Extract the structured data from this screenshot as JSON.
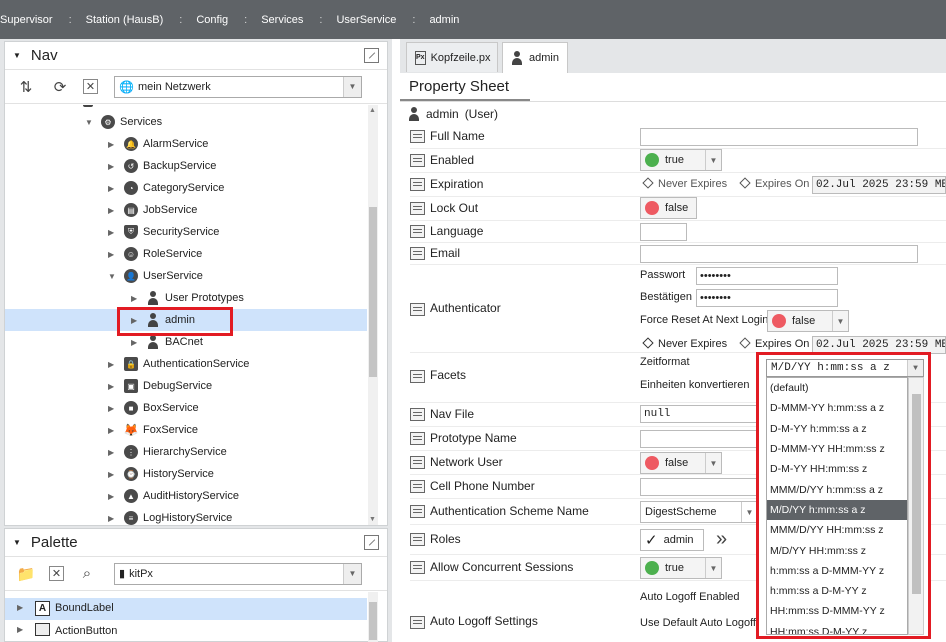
{
  "breadcrumb": [
    "Supervisor",
    "Station (HausB)",
    "Config",
    "Services",
    "UserService",
    "admin"
  ],
  "nav": {
    "title": "Nav",
    "network": "mein Netzwerk",
    "tree": [
      {
        "label": "Services",
        "level": 0,
        "expanded": true
      },
      {
        "label": "AlarmService",
        "level": 1
      },
      {
        "label": "BackupService",
        "level": 1
      },
      {
        "label": "CategoryService",
        "level": 1
      },
      {
        "label": "JobService",
        "level": 1
      },
      {
        "label": "SecurityService",
        "level": 1
      },
      {
        "label": "RoleService",
        "level": 1
      },
      {
        "label": "UserService",
        "level": 1,
        "expanded": true
      },
      {
        "label": "User Prototypes",
        "level": 2
      },
      {
        "label": "admin",
        "level": 2,
        "selected": true
      },
      {
        "label": "BACnet",
        "level": 2
      },
      {
        "label": "AuthenticationService",
        "level": 1
      },
      {
        "label": "DebugService",
        "level": 1
      },
      {
        "label": "BoxService",
        "level": 1
      },
      {
        "label": "FoxService",
        "level": 1
      },
      {
        "label": "HierarchyService",
        "level": 1
      },
      {
        "label": "HistoryService",
        "level": 1
      },
      {
        "label": "AuditHistoryService",
        "level": 1
      },
      {
        "label": "LogHistoryService",
        "level": 1
      }
    ]
  },
  "palette": {
    "title": "Palette",
    "module": "kitPx",
    "items": [
      "BoundLabel",
      "ActionButton"
    ]
  },
  "tabs": [
    "Kopfzeile.px",
    "admin"
  ],
  "property_sheet": {
    "title": "Property Sheet",
    "root": "admin",
    "root_type": "(User)",
    "full_name_label": "Full Name",
    "enabled_label": "Enabled",
    "enabled_value": "true",
    "expiration_label": "Expiration",
    "never_expires": "Never Expires",
    "expires_on": "Expires On",
    "expiration_date": "02.Jul 2025 23:59 ME",
    "lockout_label": "Lock Out",
    "lockout_value": "false",
    "language_label": "Language",
    "email_label": "Email",
    "authenticator_label": "Authenticator",
    "passwort_label": "Passwort",
    "passwort_value": "••••••••",
    "bestaetigen_label": "Bestätigen",
    "bestaetigen_value": "••••••••",
    "force_reset_label": "Force Reset At Next Login",
    "force_reset_value": "false",
    "auth_never_expires": "Never Expires",
    "auth_expires_on": "Expires On",
    "auth_expiration_date": "02.Jul 2025 23:59 ME",
    "facets_label": "Facets",
    "zeitformat_label": "Zeitformat",
    "einheiten_label": "Einheiten konvertieren",
    "nav_file_label": "Nav File",
    "nav_file_value": "null",
    "prototype_label": "Prototype Name",
    "network_user_label": "Network User",
    "network_user_value": "false",
    "cell_phone_label": "Cell Phone Number",
    "auth_scheme_label": "Authentication Scheme Name",
    "auth_scheme_value": "DigestScheme",
    "roles_label": "Roles",
    "roles_value": "admin",
    "concurrent_label": "Allow Concurrent Sessions",
    "concurrent_value": "true",
    "auto_logoff_label": "Auto Logoff Settings",
    "auto_logoff_enabled": "Auto Logoff Enabled",
    "use_default_auto": "Use Default Auto Logoff"
  },
  "zeitformat_dropdown": {
    "current": "M/D/YY h:mm:ss a z",
    "options": [
      "(default)",
      "D-MMM-YY h:mm:ss a z",
      "D-M-YY h:mm:ss a z",
      "D-MMM-YY HH:mm:ss z",
      "D-M-YY HH:mm:ss z",
      "MMM/D/YY h:mm:ss a z",
      "M/D/YY h:mm:ss a z",
      "MMM/D/YY HH:mm:ss z",
      "M/D/YY HH:mm:ss z",
      "h:mm:ss a D-MMM-YY z",
      "h:mm:ss a D-M-YY z",
      "HH:mm:ss D-MMM-YY z",
      "HH:mm:ss D-M-YY z"
    ],
    "selected_index": 6
  },
  "colors": {
    "highlight": "#e21b23",
    "selection": "#cfe3fb",
    "topbar": "#5f6367"
  }
}
